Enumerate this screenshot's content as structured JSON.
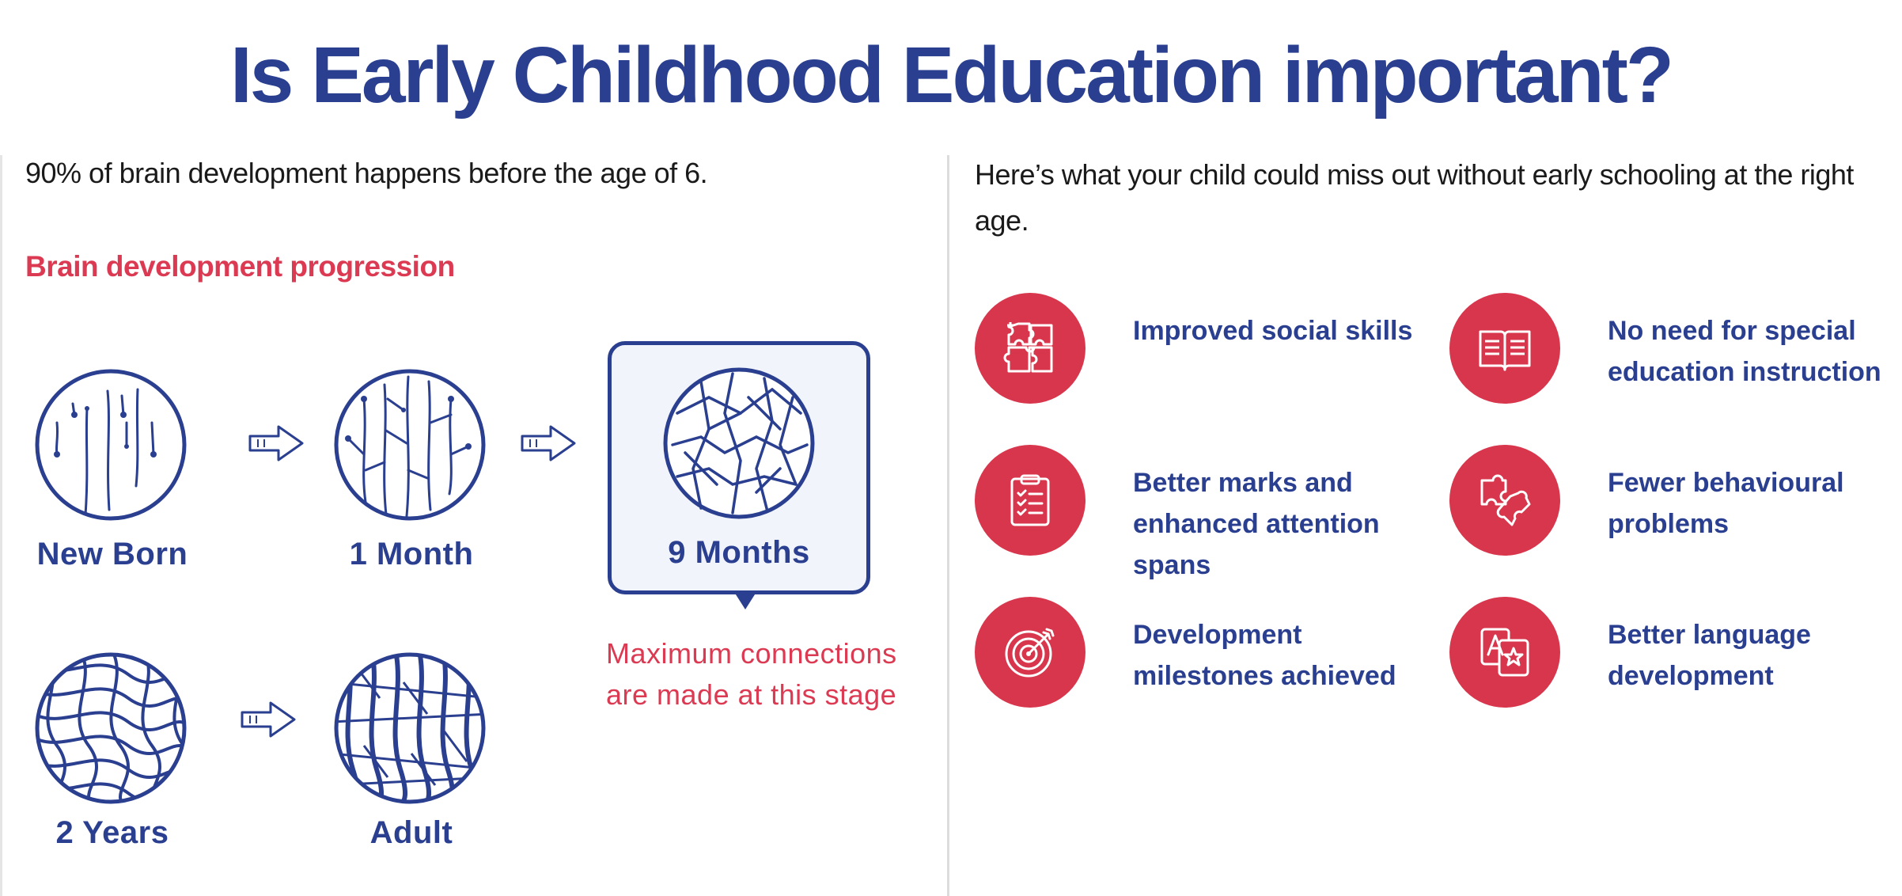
{
  "header": {
    "title": "Is Early Childhood Education important?"
  },
  "left": {
    "intro": "90% of brain development happens before the age of 6.",
    "section_title": "Brain development progression",
    "stages": [
      {
        "label": "New Born"
      },
      {
        "label": "1 Month"
      },
      {
        "label": "9 Months"
      },
      {
        "label": "2 Years"
      },
      {
        "label": "Adult"
      }
    ],
    "note": "Maximum connections are made at this stage"
  },
  "right": {
    "intro": "Here’s what your child could miss out without early schooling at the right age.",
    "benefits": [
      {
        "label": "Improved social skills",
        "icon": "puzzle-icon"
      },
      {
        "label": "No need for special education instruction",
        "icon": "open-book-icon"
      },
      {
        "label": "Better marks and enhanced attention spans",
        "icon": "checklist-icon"
      },
      {
        "label": "Fewer behavioural problems",
        "icon": "puzzle-piece-icon"
      },
      {
        "label": "Development milestones achieved",
        "icon": "target-icon"
      },
      {
        "label": "Better language development",
        "icon": "translate-icon"
      }
    ]
  },
  "colors": {
    "primary_blue": "#2a3f8f",
    "accent_red": "#d8364c",
    "highlight_bg": "#f1f5fb"
  }
}
